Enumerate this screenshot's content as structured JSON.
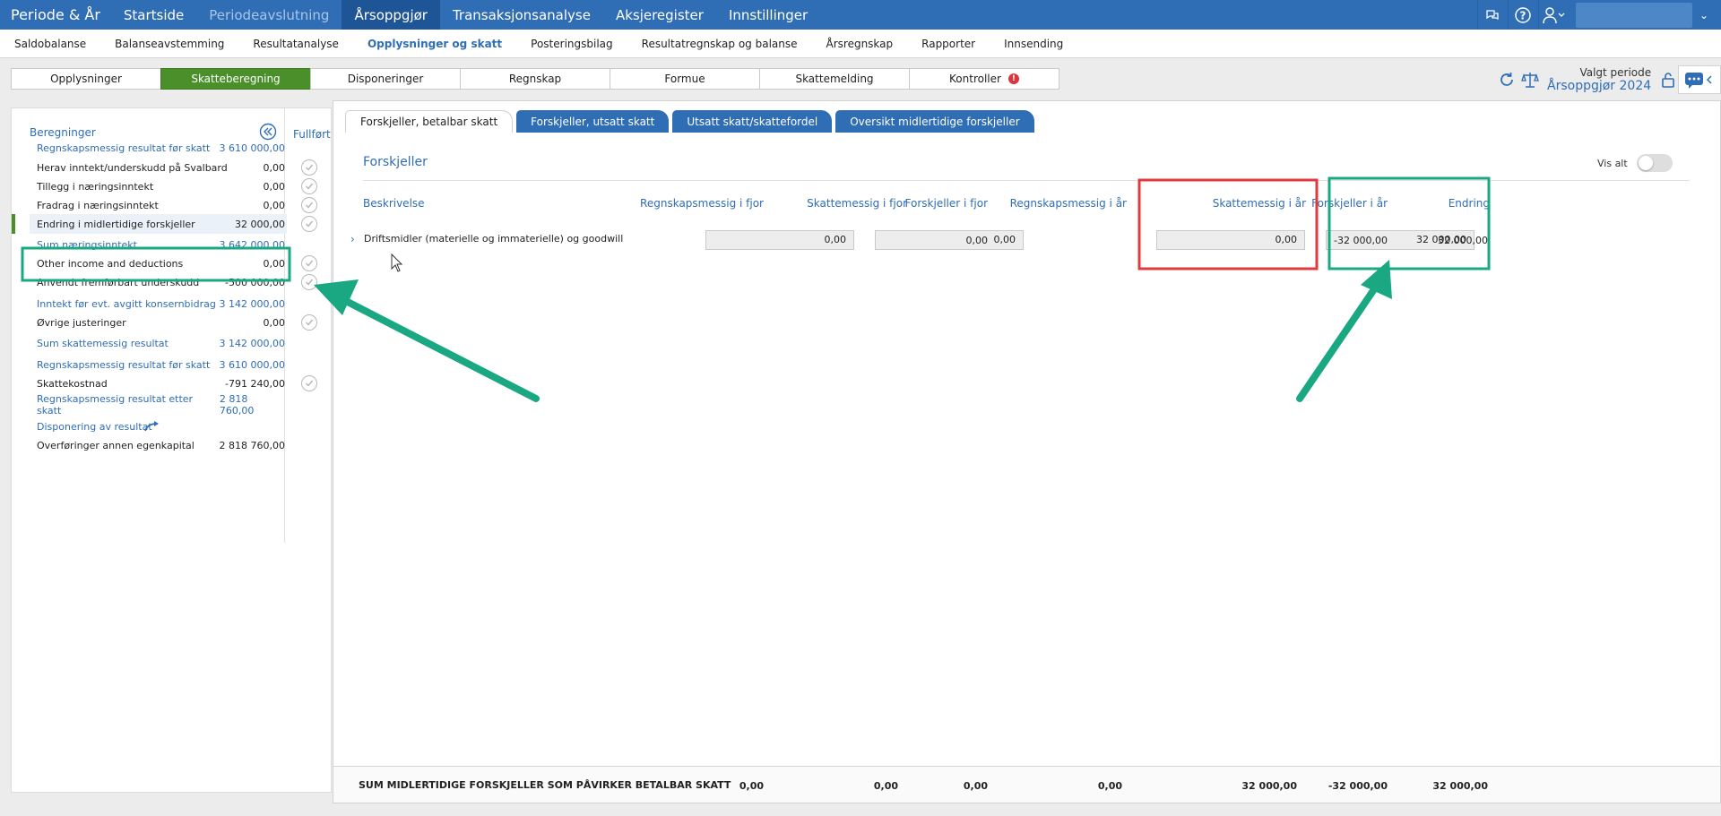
{
  "topnav": {
    "brand": "Periode & År",
    "items": [
      {
        "label": "Startside",
        "state": "normal"
      },
      {
        "label": "Periodeavslutning",
        "state": "disabled"
      },
      {
        "label": "Årsoppgjør",
        "state": "active"
      },
      {
        "label": "Transaksjonsanalyse",
        "state": "normal"
      },
      {
        "label": "Aksjeregister",
        "state": "normal"
      },
      {
        "label": "Innstillinger",
        "state": "normal"
      }
    ],
    "caret": "⌄"
  },
  "subnav": {
    "items": [
      "Saldobalanse",
      "Balanseavstemming",
      "Resultatanalyse",
      "Opplysninger og skatt",
      "Posteringsbilag",
      "Resultatregnskap og balanse",
      "Årsregnskap",
      "Rapporter",
      "Innsending"
    ],
    "active_index": 3
  },
  "steps": {
    "items": [
      "Opplysninger",
      "Skatteberegning",
      "Disponeringer",
      "Regnskap",
      "Formue",
      "Skattemelding",
      "Kontroller"
    ],
    "active_index": 1,
    "alert_glyph": "!"
  },
  "period": {
    "label": "Valgt periode",
    "value": "Årsoppgjør 2024"
  },
  "left": {
    "heading": "Beregninger",
    "done_heading": "Fullført",
    "rows": [
      {
        "label": "Regnskapsmessig resultat før skatt",
        "value": "3 610 000,00",
        "sum": true,
        "check": false
      },
      {
        "label": "Herav inntekt/underskudd på Svalbard",
        "value": "0,00",
        "sum": false,
        "check": true
      },
      {
        "label": "Tillegg i næringsinntekt",
        "value": "0,00",
        "sum": false,
        "check": true
      },
      {
        "label": "Fradrag i næringsinntekt",
        "value": "0,00",
        "sum": false,
        "check": true
      },
      {
        "label": "Endring i midlertidige forskjeller",
        "value": "32 000,00",
        "sum": false,
        "check": true,
        "selected": true
      },
      {
        "label": "Sum næringsinntekt",
        "value": "3 642 000,00",
        "sum": true,
        "check": false
      },
      {
        "label": "Other income and deductions",
        "value": "0,00",
        "sum": false,
        "check": true
      },
      {
        "label": "Anvendt fremførbart underskudd",
        "value": "-500 000,00",
        "sum": false,
        "check": true
      },
      {
        "label": "Inntekt før evt. avgitt konsernbidrag",
        "value": "3 142 000,00",
        "sum": true,
        "check": false
      },
      {
        "label": "Øvrige justeringer",
        "value": "0,00",
        "sum": false,
        "check": true
      },
      {
        "label": "Sum skattemessig resultat",
        "value": "3 142 000,00",
        "sum": true,
        "check": false
      },
      {
        "label": "Regnskapsmessig resultat før skatt",
        "value": "3 610 000,00",
        "sum": true,
        "check": false
      },
      {
        "label": "Skattekostnad",
        "value": "-791 240,00",
        "sum": false,
        "check": true
      },
      {
        "label": "Regnskapsmessig resultat etter skatt",
        "value": "2 818 760,00",
        "sum": true,
        "check": false
      },
      {
        "label": "Disponering av resultat",
        "value": "",
        "sum": true,
        "check": false
      },
      {
        "label": "Overføringer annen egenkapital",
        "value": "2 818 760,00",
        "sum": false,
        "check": false
      }
    ]
  },
  "tabs": [
    "Forskjeller, betalbar skatt",
    "Forskjeller, utsatt skatt",
    "Utsatt skatt/skattefordel",
    "Oversikt midlertidige forskjeller"
  ],
  "main": {
    "section_title": "Forskjeller",
    "vis_alt": "Vis alt",
    "columns": [
      "Beskrivelse",
      "Regnskapsmessig i fjor",
      "Skattemessig i fjor",
      "Forskjeller i fjor",
      "Regnskapsmessig i år",
      "Skattemessig i år",
      "Forskjeller i år",
      "Endring"
    ],
    "row": {
      "chevron": "›",
      "description": "Driftsmidler (materielle og immaterielle) og goodwill",
      "regnskap_fjor": "0,00",
      "skatt_fjor": "0,00",
      "forskjell_fjor": "0,00",
      "regnskap_aar": "0,00",
      "skatt_aar": "32 000,00",
      "forskjell_aar": "-32 000,00",
      "endring": "32 000,00"
    },
    "sum": {
      "label": "SUM MIDLERTIDIGE FORSKJELLER SOM PÅVIRKER BETALBAR SKATT",
      "values": [
        "0,00",
        "0,00",
        "0,00",
        "0,00",
        "32 000,00",
        "-32 000,00",
        "32 000,00"
      ]
    }
  },
  "colors": {
    "brand_blue": "#2f6db5",
    "active_green": "#4b8f2a",
    "highlight_teal": "#1aa882",
    "highlight_red": "#e0393e"
  }
}
